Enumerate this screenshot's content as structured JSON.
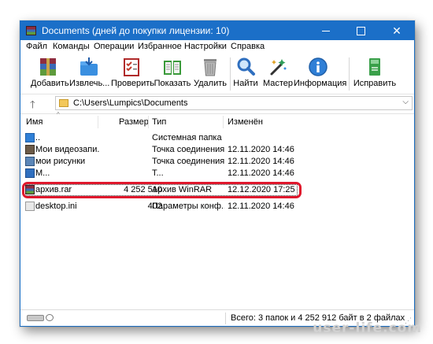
{
  "window": {
    "title": "Documents (дней до покупки лицензии: 10)",
    "controls": {
      "minimize": "",
      "maximize": "",
      "close": "✕"
    }
  },
  "menu": [
    "Файл",
    "Команды",
    "Операции",
    "Избранное",
    "Настройки",
    "Справка"
  ],
  "toolbar": [
    {
      "label": "Добавить",
      "icon": "add-archive-icon"
    },
    {
      "label": "Извлечь...",
      "icon": "extract-icon"
    },
    {
      "label": "Проверить",
      "icon": "test-icon"
    },
    {
      "label": "Показать",
      "icon": "view-book-icon"
    },
    {
      "label": "Удалить",
      "icon": "trash-icon"
    },
    {
      "label": "Найти",
      "icon": "magnifier-icon"
    },
    {
      "label": "Мастер",
      "icon": "wizard-wand-icon"
    },
    {
      "label": "Информация",
      "icon": "info-icon"
    },
    {
      "label": "Исправить",
      "icon": "repair-icon"
    }
  ],
  "address": {
    "path": "C:\\Users\\Lumpics\\Documents",
    "up_symbol": "🡑",
    "dropdown_symbol": "⌵"
  },
  "columns": {
    "name": "Имя",
    "size": "Размер",
    "type": "Тип",
    "modified": "Изменён"
  },
  "rows": [
    {
      "name": "..",
      "size": "",
      "type": "Системная папка",
      "modified": "",
      "icon": "parent-folder-icon"
    },
    {
      "name": "Мои видеозапи...",
      "size": "",
      "type": "Точка соединения",
      "modified": "12.11.2020 14:46",
      "icon": "videos-folder-icon"
    },
    {
      "name": "мои рисунки",
      "size": "",
      "type": "Точка соединения",
      "modified": "12.11.2020 14:46",
      "icon": "pictures-folder-icon"
    },
    {
      "name": "М...",
      "size": "",
      "type": "Т...",
      "modified": "12.11.2020 14:46",
      "icon": "music-folder-icon"
    },
    {
      "name": "архив.rar",
      "size": "4 252 510",
      "type": "Архив WinRAR",
      "modified": "12.12.2020 17:25",
      "icon": "rar-archive-icon"
    },
    {
      "name": "desktop.ini",
      "size": "402",
      "type": "Параметры конф...",
      "modified": "12.11.2020 14:46",
      "icon": "ini-file-icon"
    }
  ],
  "status": {
    "text": "Всего: 3 папок и 4 252 912 байт в 2 файлах"
  },
  "watermark": "user-life.com",
  "colors": {
    "titlebar": "#1b6fc8",
    "highlight": "#e0182d"
  }
}
